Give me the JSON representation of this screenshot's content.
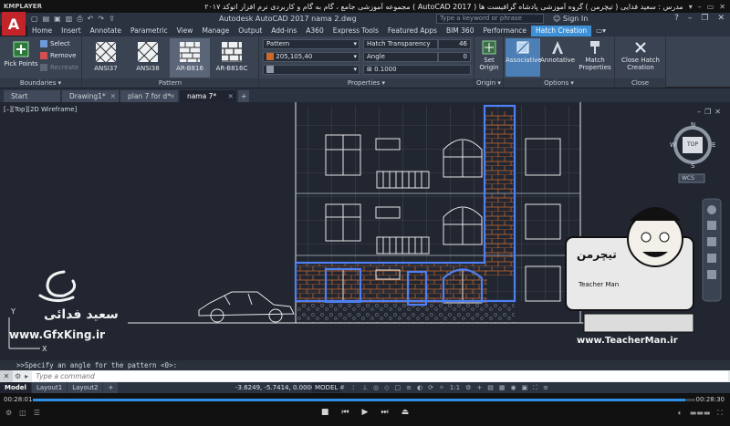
{
  "player": {
    "logo": "KMPLAYER",
    "title": "مجموعه آموزشی جامع ، گام به گام و کاربردی نرم افزار اتوکد ۲۰۱۷ ( AutoCAD 2017 ) مدرس : سعید فدایی ( تیچرمن ) گروه آموزشی پادشاه گرافیست ها",
    "time_elapsed": "00:28:01",
    "time_total": "00:28:30",
    "progress_fraction": 0.985
  },
  "acad": {
    "file_title": "Autodesk AutoCAD 2017    nama 2.dwg",
    "search_placeholder": "Type a keyword or phrase",
    "signin_label": "Sign In"
  },
  "ribbon_tabs": [
    "Home",
    "Insert",
    "Annotate",
    "Parametric",
    "View",
    "Manage",
    "Output",
    "Add-ins",
    "A360",
    "Express Tools",
    "Featured Apps",
    "BIM 360",
    "Performance",
    "Hatch Creation"
  ],
  "ribbon": {
    "boundaries": {
      "title": "Boundaries",
      "pick_points": "Pick Points",
      "select": "Select",
      "remove": "Remove",
      "recreate": "Recreate"
    },
    "pattern": {
      "title": "Pattern",
      "swatches": [
        "ANSI37",
        "ANSI38",
        "AR-B816",
        "AR-B816C"
      ]
    },
    "properties": {
      "title": "Properties",
      "type": "Pattern",
      "color": "205,105,40",
      "transparency_label": "Hatch Transparency",
      "transparency_value": "46",
      "angle_label": "Angle",
      "angle_value": "0",
      "scale_value": "0.1000"
    },
    "origin": {
      "title": "Origin",
      "set_origin": "Set Origin"
    },
    "options": {
      "title": "Options",
      "associative": "Associative",
      "annotative": "Annotative",
      "match_properties": "Match Properties"
    },
    "close": {
      "title": "Close",
      "close_label": "Close Hatch Creation"
    }
  },
  "doc_tabs": [
    "Start",
    "Drawing1*",
    "plan 7 for d*",
    "nama 7*"
  ],
  "canvas": {
    "viewport_label": "[–][Top][2D Wireframe]",
    "viewcube_top": "TOP",
    "compass": {
      "n": "N",
      "s": "S",
      "e": "E",
      "w": "W"
    },
    "wcs": "WCS",
    "watermark_name": "سعید فدائی",
    "watermark_site": "www.GfxKing.ir",
    "watermark_site2": "www.TeacherMan.ir",
    "badge_text": "تیچرمن",
    "badge_sub": "Teacher Man"
  },
  "command": {
    "history": ">>Specify an angle for the pattern <0>:",
    "placeholder": "Type a command"
  },
  "status": {
    "layout_tabs": [
      "Model",
      "Layout1",
      "Layout2"
    ],
    "coords": "-3.6249, -5.7414, 0.0000",
    "model_label": "MODEL",
    "scale": "1:1"
  },
  "colors": {
    "hatch": "#cd6928",
    "selection": "#4f7ff0",
    "lines": "#e6e6e6",
    "accent_tab": "#3d8fd6"
  }
}
